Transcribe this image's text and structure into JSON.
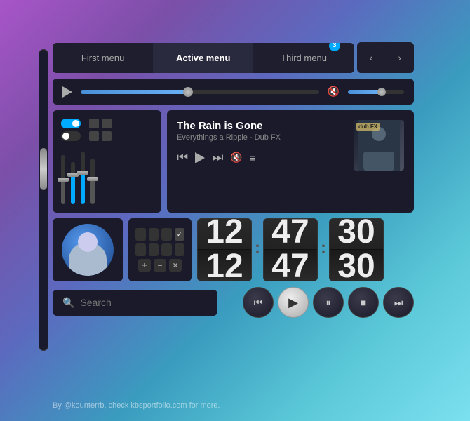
{
  "menu": {
    "tabs": [
      {
        "id": "first",
        "label": "First menu",
        "active": false
      },
      {
        "id": "active",
        "label": "Active menu",
        "active": true
      },
      {
        "id": "third",
        "label": "Third menu",
        "active": false
      }
    ],
    "badge": "3",
    "prev_label": "‹",
    "next_label": "›"
  },
  "player": {
    "progress_pct": 45,
    "volume_pct": 60
  },
  "music": {
    "title": "The Rain is Gone",
    "artist": "Everythings a Ripple - Dub FX",
    "album_label": "dub FX"
  },
  "flip_clock": {
    "hours": "12",
    "minutes": "47",
    "seconds": "30"
  },
  "search": {
    "placeholder": "Search",
    "value": ""
  },
  "footer": {
    "text": "By @kounterrb, check kbsportfolio.com for more."
  },
  "controls": {
    "rewind": "⏮",
    "play": "▶",
    "pause": "⏸",
    "stop": "■",
    "forward": "⏭"
  }
}
